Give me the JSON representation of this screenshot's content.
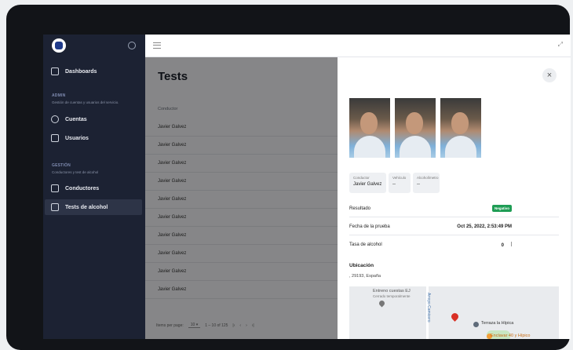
{
  "sidebar": {
    "nav_dashboards": "Dashboards",
    "sec_admin_title": "ADMIN",
    "sec_admin_sub": "Gestión de cuentas y usuarios del servicio.",
    "nav_cuentas": "Cuentas",
    "nav_usuarios": "Usuarios",
    "sec_gestion_title": "GESTIÓN",
    "sec_gestion_sub": "Conductores y test de alcohol",
    "nav_conductores": "Conductores",
    "nav_tests": "Tests de alcohol"
  },
  "page": {
    "title": "Tests",
    "column_header": "Conductor",
    "rows": [
      "Javier Galvez",
      "Javier Galvez",
      "Javier Galvez",
      "Javier Galvez",
      "Javier Galvez",
      "Javier Galvez",
      "Javier Galvez",
      "Javier Galvez",
      "Javier Galvez",
      "Javier Galvez"
    ],
    "pager_label": "Items per page:",
    "pager_value": "10",
    "pager_range": "1 – 10 of 125"
  },
  "panel": {
    "chip_conductor_label": "Conductor",
    "chip_conductor_value": "Javier Galvez",
    "chip_vehiculo_label": "Vehículo",
    "chip_vehiculo_value": "--",
    "chip_alcoholimetro_label": "Alcoholímetro",
    "chip_alcoholimetro_value": "--",
    "resultado_label": "Resultado",
    "resultado_value": "Negativo",
    "fecha_label": "Fecha de la prueba",
    "fecha_value": "Oct 25, 2022, 2:53:49 PM",
    "tasa_label": "Tasa de alcohol",
    "tasa_value": "0",
    "ubicacion_title": "Ubicación",
    "ubicacion_value": ", 29193, España",
    "map": {
      "place1": "Entreno cuestas EJ",
      "place1_sub": "Cerrado temporalmente",
      "street": "Arroyo Camicero",
      "place2": "Terraza la Hípica",
      "place3": "Enclavar 40 y Hípico"
    }
  },
  "colors": {
    "sidebar": "#1c2233",
    "badge": "#1f9d55",
    "pin": "#d93025"
  }
}
